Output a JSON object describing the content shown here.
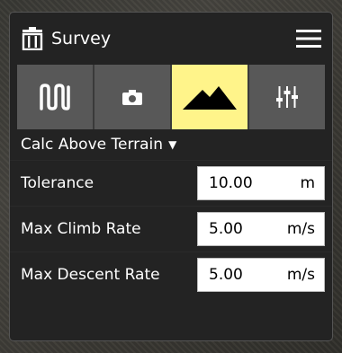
{
  "panel": {
    "title": "Survey",
    "header_icon": "trash-icon",
    "menu_icon": "hamburger-menu-icon"
  },
  "tabs": [
    {
      "icon": "zigzag-pattern-icon",
      "active": false
    },
    {
      "icon": "camera-icon",
      "active": false
    },
    {
      "icon": "mountain-terrain-icon",
      "active": true
    },
    {
      "icon": "sliders-icon",
      "active": false
    }
  ],
  "altitude_mode": {
    "label": "Calc Above Terrain"
  },
  "fields": [
    {
      "label": "Tolerance",
      "value": "10.00",
      "unit": "m"
    },
    {
      "label": "Max Climb Rate",
      "value": "5.00",
      "unit": "m/s"
    },
    {
      "label": "Max Descent Rate",
      "value": "5.00",
      "unit": "m/s"
    }
  ],
  "colors": {
    "panel_bg": "#232323",
    "tab_bg": "#585858",
    "tab_active_bg": "#fff48a",
    "text": "#ffffff"
  }
}
